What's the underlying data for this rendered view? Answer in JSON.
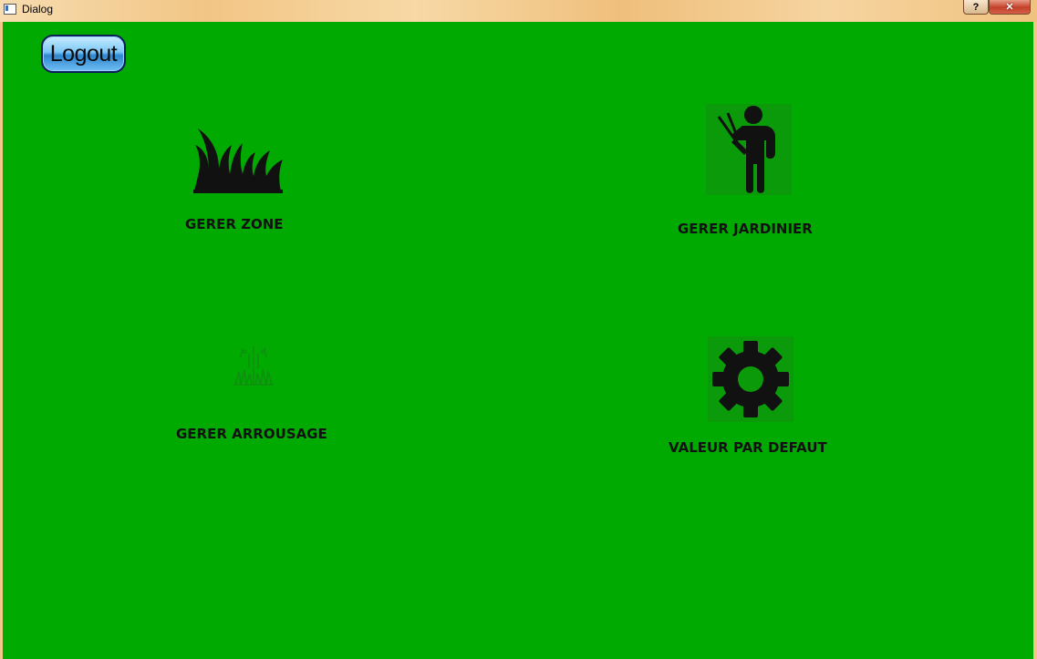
{
  "window": {
    "title": "Dialog",
    "help_label": "?",
    "close_label": "✕"
  },
  "logout": {
    "label": "Logout"
  },
  "tiles": {
    "zone": {
      "label": "GERER ZONE",
      "icon": "grass-icon"
    },
    "jardinier": {
      "label": "GERER JARDINIER",
      "icon": "gardener-icon"
    },
    "arrousage": {
      "label": "GERER ARROUSAGE",
      "icon": "sprinkler-icon"
    },
    "defaut": {
      "label": "VALEUR PAR DEFAUT",
      "icon": "gear-icon"
    }
  },
  "colors": {
    "background": "#00aa00",
    "text": "#111111"
  }
}
